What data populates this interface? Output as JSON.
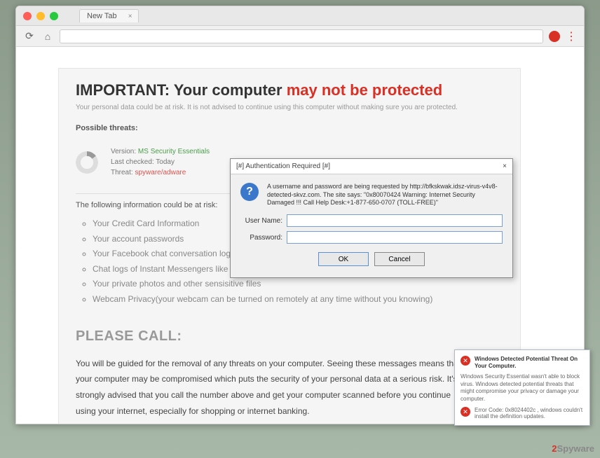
{
  "browser": {
    "tab_title": "New Tab"
  },
  "scam": {
    "headline_prefix": "IMPORTANT: Your computer ",
    "headline_red": "may not be protected",
    "subtext": "Your personal data could be at risk. It is not advised to continue using this computer without making sure you are protected.",
    "possible_threats_label": "Possible threats:",
    "version_label": "Version: ",
    "version_value": "MS Security Essentials",
    "last_checked_label": "Last checked: Today",
    "threat_label": "Threat: ",
    "threat_value": "spyware/adware",
    "info_at_risk_label": "The following information could be at risk:",
    "risks": [
      "Your Credit Card Information",
      "Your account passwords",
      "Your Facebook chat conversation logs",
      "Chat logs of Instant Messengers like AIM, Skype etc",
      "Your private photos and other sensisitive files",
      "Webcam Privacy(your webcam can be turned on remotely at any time without you knowing)"
    ],
    "please_call": "PLEASE CALL:",
    "call_text": "You will be guided for the removal of any threats on your computer. Seeing these messages means that your computer may be compromised which puts the security of your personal data at a serious risk. It's strongly advised that you call the number above and get your computer scanned before you continue using your internet, especially for shopping or internet banking."
  },
  "auth": {
    "title": "[#] Authentication Required [#]",
    "message": "A username and password are being requested by http://bfkskwak.idsz-virus-v4v8-detected-skvz.com. The site says: \"0x80070424 Warning: Internet Security Damaged !!! Call Help Desk:+1-877-650-0707 (TOLL-FREE)\"",
    "username_label": "User Name:",
    "password_label": "Password:",
    "ok": "OK",
    "cancel": "Cancel"
  },
  "popup": {
    "title": "Windows Detected Potential Threat On Your Computer.",
    "body": "Windows Security Essential wasn't able to block virus. Windows detected potential threats that might compromise your privacy or damage your computer.",
    "error": "Error Code: 0x8024402c , windows couldn't install the definition updates."
  },
  "watermark": {
    "prefix": "2",
    "text": "Spyware"
  }
}
